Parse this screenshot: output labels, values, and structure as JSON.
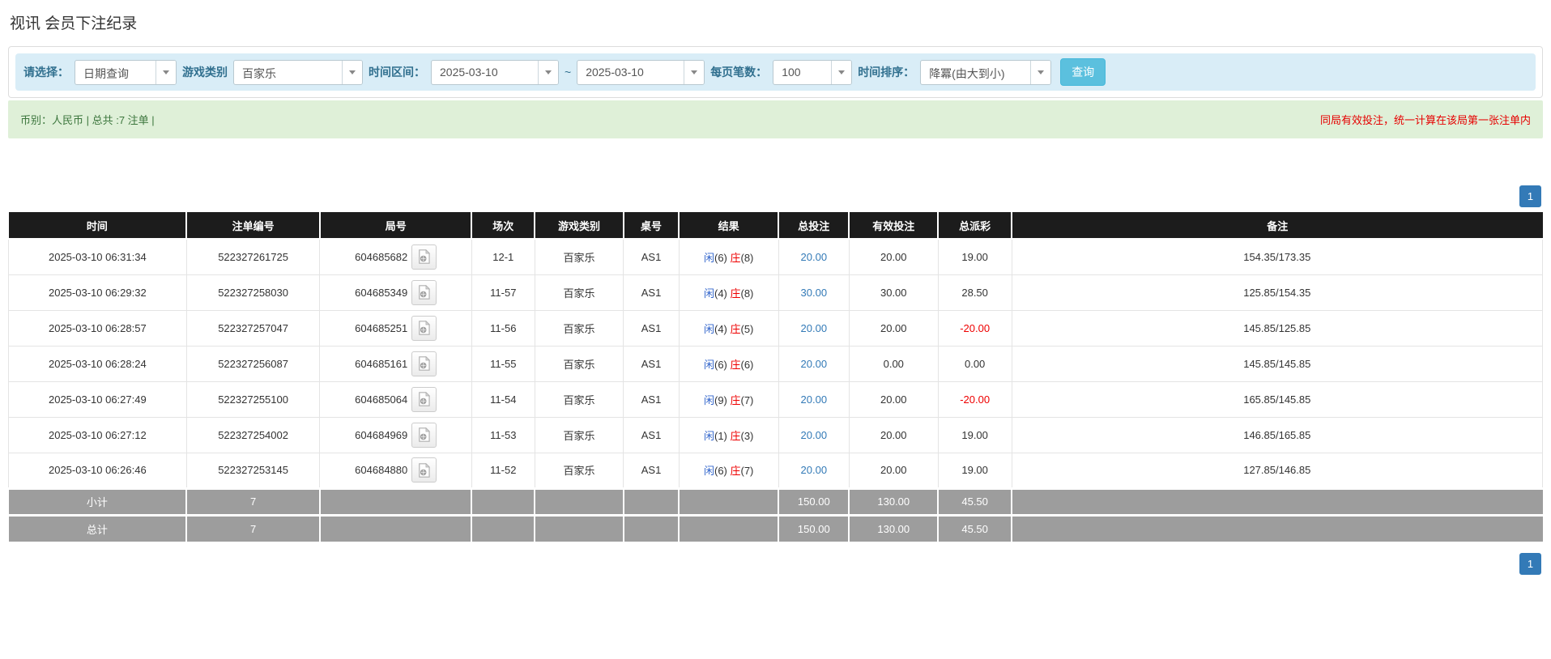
{
  "page": {
    "title": "视讯 会员下注纪录"
  },
  "filters": {
    "select_label": "请选择：",
    "select_value": "日期查询",
    "game_type_label": "游戏类别",
    "game_type_value": "百家乐",
    "time_range_label": "时间区间：",
    "date_from": "2025-03-10",
    "tilde": "~",
    "date_to": "2025-03-10",
    "page_size_label": "每页笔数：",
    "page_size_value": "100",
    "sort_label": "时间排序：",
    "sort_value": "降冪(由大到小)",
    "search_button": "查询"
  },
  "info_bar": {
    "left": "币别：人民币 | 总共 :7 注单 |",
    "right": "同局有效投注，统一计算在该局第一张注单内"
  },
  "pagination": {
    "page": "1"
  },
  "icons": {
    "video": "video-record-icon",
    "caret": "chevron-down-icon"
  },
  "table": {
    "headers": [
      "时间",
      "注单编号",
      "局号",
      "场次",
      "游戏类别",
      "桌号",
      "结果",
      "总投注",
      "有效投注",
      "总派彩",
      "备注"
    ],
    "col_widths": [
      "11.6%",
      "8.7%",
      "9.9%",
      "4.1%",
      "5.8%",
      "3.6%",
      "6.5%",
      "4.6%",
      "5.8%",
      "4.8%",
      "34.6%"
    ],
    "result_labels": {
      "player": "闲",
      "banker": "庄"
    },
    "rows": [
      {
        "time": "2025-03-10 06:31:34",
        "bet_id": "522327261725",
        "round": "604685682",
        "session": "12-1",
        "game": "百家乐",
        "table_no": "AS1",
        "result": {
          "player": "6",
          "banker": "8"
        },
        "total_bet": "20.00",
        "valid_bet": "20.00",
        "payout": "19.00",
        "remark": "154.35/173.35"
      },
      {
        "time": "2025-03-10 06:29:32",
        "bet_id": "522327258030",
        "round": "604685349",
        "session": "11-57",
        "game": "百家乐",
        "table_no": "AS1",
        "result": {
          "player": "4",
          "banker": "8"
        },
        "total_bet": "30.00",
        "valid_bet": "30.00",
        "payout": "28.50",
        "remark": "125.85/154.35"
      },
      {
        "time": "2025-03-10 06:28:57",
        "bet_id": "522327257047",
        "round": "604685251",
        "session": "11-56",
        "game": "百家乐",
        "table_no": "AS1",
        "result": {
          "player": "4",
          "banker": "5"
        },
        "total_bet": "20.00",
        "valid_bet": "20.00",
        "payout": "-20.00",
        "remark": "145.85/125.85"
      },
      {
        "time": "2025-03-10 06:28:24",
        "bet_id": "522327256087",
        "round": "604685161",
        "session": "11-55",
        "game": "百家乐",
        "table_no": "AS1",
        "result": {
          "player": "6",
          "banker": "6"
        },
        "total_bet": "20.00",
        "valid_bet": "0.00",
        "payout": "0.00",
        "remark": "145.85/145.85"
      },
      {
        "time": "2025-03-10 06:27:49",
        "bet_id": "522327255100",
        "round": "604685064",
        "session": "11-54",
        "game": "百家乐",
        "table_no": "AS1",
        "result": {
          "player": "9",
          "banker": "7"
        },
        "total_bet": "20.00",
        "valid_bet": "20.00",
        "payout": "-20.00",
        "remark": "165.85/145.85"
      },
      {
        "time": "2025-03-10 06:27:12",
        "bet_id": "522327254002",
        "round": "604684969",
        "session": "11-53",
        "game": "百家乐",
        "table_no": "AS1",
        "result": {
          "player": "1",
          "banker": "3"
        },
        "total_bet": "20.00",
        "valid_bet": "20.00",
        "payout": "19.00",
        "remark": "146.85/165.85"
      },
      {
        "time": "2025-03-10 06:26:46",
        "bet_id": "522327253145",
        "round": "604684880",
        "session": "11-52",
        "game": "百家乐",
        "table_no": "AS1",
        "result": {
          "player": "6",
          "banker": "7"
        },
        "total_bet": "20.00",
        "valid_bet": "20.00",
        "payout": "19.00",
        "remark": "127.85/146.85"
      }
    ],
    "summaries": [
      {
        "label": "小计",
        "count": "7",
        "total_bet": "150.00",
        "valid_bet": "130.00",
        "payout": "45.50"
      },
      {
        "label": "总计",
        "count": "7",
        "total_bet": "150.00",
        "valid_bet": "130.00",
        "payout": "45.50"
      }
    ]
  }
}
